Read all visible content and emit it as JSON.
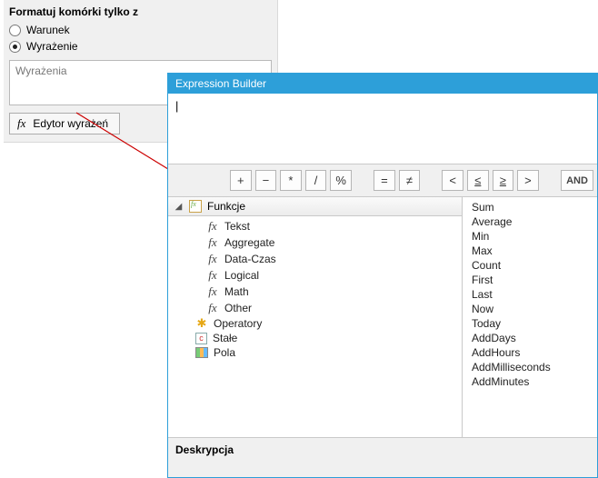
{
  "left": {
    "title": "Formatuj komórki tylko z",
    "radio_condition": "Warunek",
    "radio_expression": "Wyrażenie",
    "radio_selected": "expression",
    "placeholder": "Wyrażenia",
    "editor_button": "Edytor wyrażeń"
  },
  "builder": {
    "title": "Expression Builder",
    "input_value": "",
    "toolbar": {
      "plus": "+",
      "minus": "−",
      "mul": "*",
      "div": "/",
      "pct": "%",
      "eq": "=",
      "neq": "≠",
      "lt": "<",
      "lte": "≤",
      "gte": "≥",
      "gt": ">",
      "and": "AND"
    },
    "tree": {
      "root_label": "Funkcje",
      "items": [
        {
          "label": "Tekst",
          "icon": "fx"
        },
        {
          "label": "Aggregate",
          "icon": "fx"
        },
        {
          "label": "Data-Czas",
          "icon": "fx"
        },
        {
          "label": "Logical",
          "icon": "fx"
        },
        {
          "label": "Math",
          "icon": "fx"
        },
        {
          "label": "Other",
          "icon": "fx"
        }
      ],
      "siblings": [
        {
          "label": "Operatory",
          "icon": "star"
        },
        {
          "label": "Stałe",
          "icon": "const"
        },
        {
          "label": "Pola",
          "icon": "fields"
        }
      ]
    },
    "functions": [
      "Sum",
      "Average",
      "Min",
      "Max",
      "Count",
      "First",
      "Last",
      "Now",
      "Today",
      "AddDays",
      "AddHours",
      "AddMilliseconds",
      "AddMinutes"
    ],
    "description_label": "Deskrypcja"
  }
}
